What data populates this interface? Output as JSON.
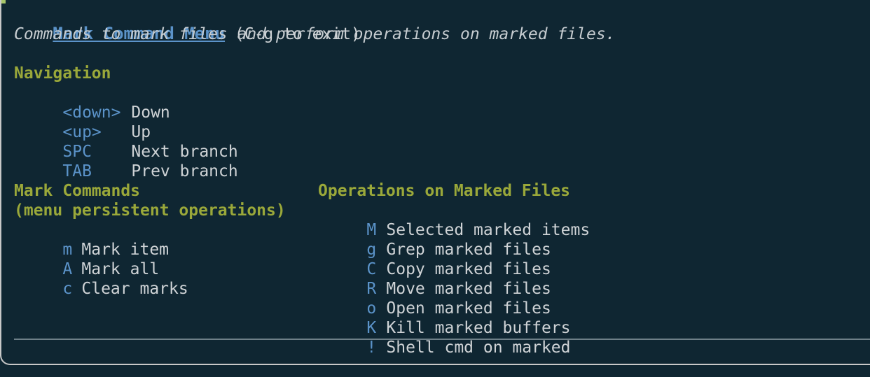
{
  "header": {
    "title": "Mark Command Menu",
    "exit_hint": "(C-g to exit)",
    "description": "Commands to mark files and perform operations on marked files."
  },
  "navigation": {
    "heading": "Navigation",
    "items": [
      {
        "key": "<down>",
        "label": "Down"
      },
      {
        "key": "<up>",
        "label": "Up"
      },
      {
        "key": "SPC",
        "label": "Next branch"
      },
      {
        "key": "TAB",
        "label": "Prev branch"
      }
    ]
  },
  "mark_commands": {
    "heading": "Mark Commands",
    "subheading": "(menu persistent operations)",
    "items": [
      {
        "key": "m",
        "label": "Mark item"
      },
      {
        "key": "A",
        "label": "Mark all"
      },
      {
        "key": "c",
        "label": "Clear marks"
      }
    ]
  },
  "operations": {
    "heading": "Operations on Marked Files",
    "items": [
      {
        "key": "M",
        "label": "Selected marked items"
      },
      {
        "key": "g",
        "label": "Grep marked files"
      },
      {
        "key": "C",
        "label": "Copy marked files"
      },
      {
        "key": "R",
        "label": "Move marked files"
      },
      {
        "key": "o",
        "label": "Open marked files"
      },
      {
        "key": "K",
        "label": "Kill marked buffers"
      },
      {
        "key": "!",
        "label": "Shell cmd on marked"
      }
    ]
  },
  "colors": {
    "background": "#0f2632",
    "heading": "#9aa83a",
    "key": "#5b93c9",
    "text": "#cfd3d6"
  }
}
